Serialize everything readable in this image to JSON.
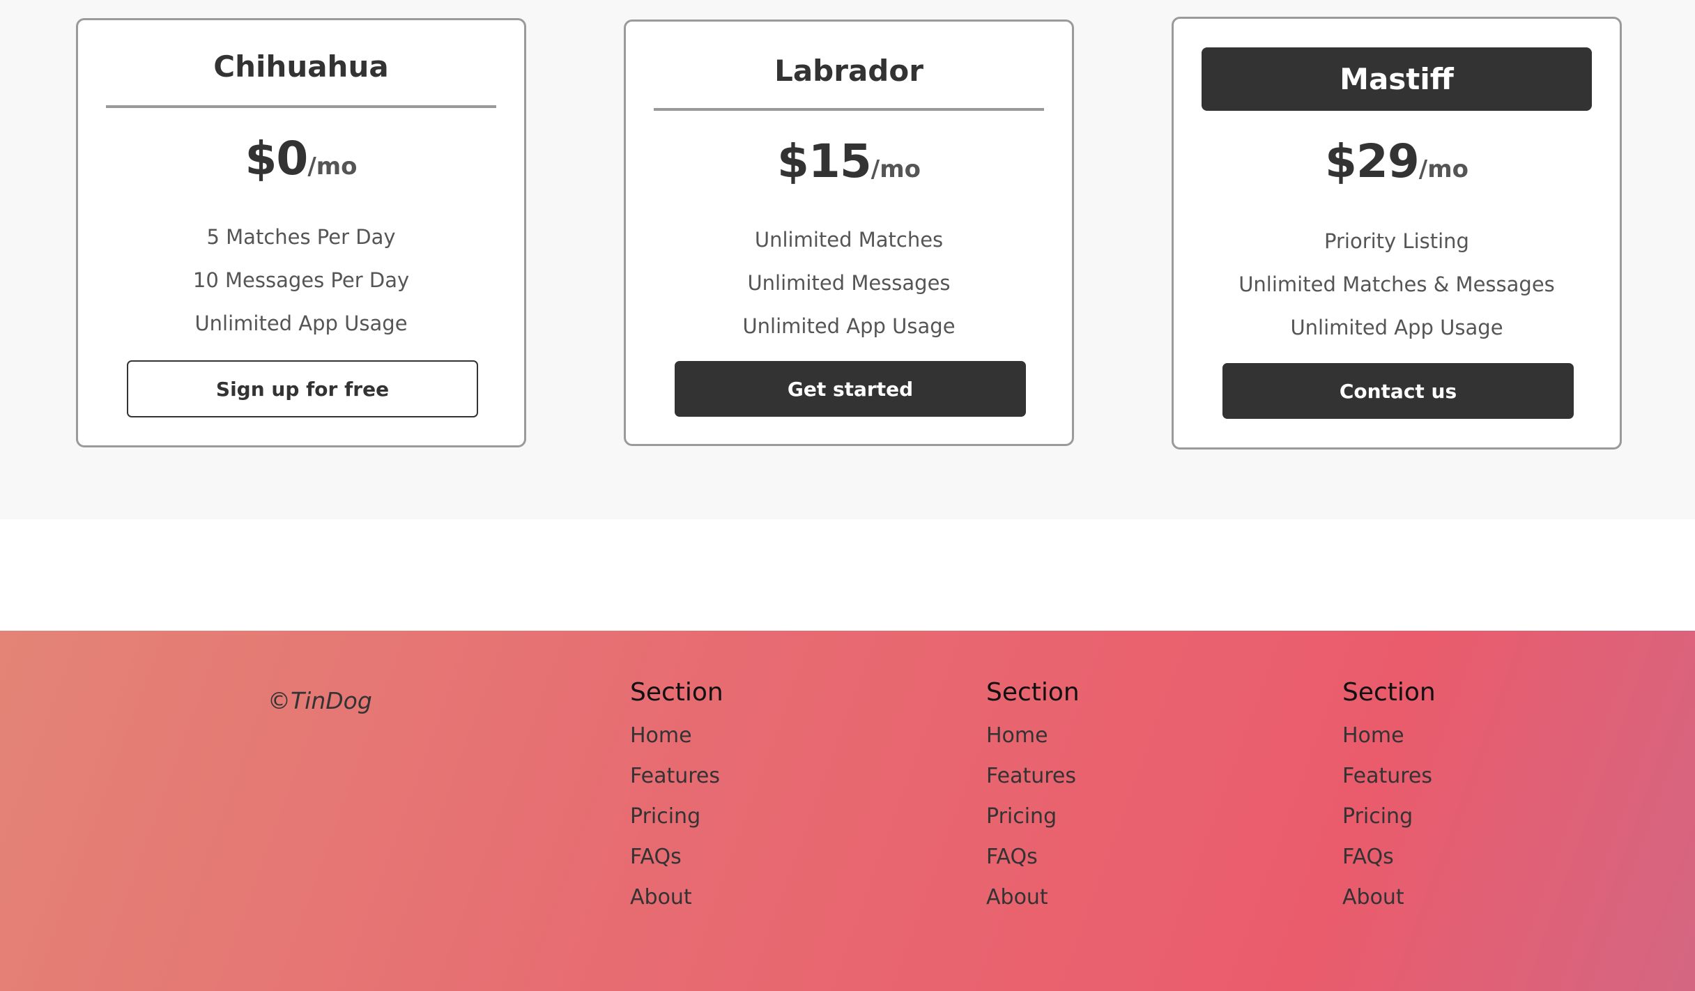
{
  "pricing": {
    "plans": [
      {
        "name": "Chihuahua",
        "price": "$0",
        "unit": "/mo",
        "features": [
          "5 Matches Per Day",
          "10 Messages Per Day",
          "Unlimited App Usage"
        ],
        "cta": "Sign up for free"
      },
      {
        "name": "Labrador",
        "price": "$15",
        "unit": "/mo",
        "features": [
          "Unlimited Matches",
          "Unlimited Messages",
          "Unlimited App Usage"
        ],
        "cta": "Get started"
      },
      {
        "name": "Mastiff",
        "price": "$29",
        "unit": "/mo",
        "features": [
          "Priority Listing",
          "Unlimited Matches & Messages",
          "Unlimited App Usage"
        ],
        "cta": "Contact us"
      }
    ]
  },
  "footer": {
    "copyright": "©TinDog",
    "columns": [
      {
        "title": "Section",
        "links": [
          "Home",
          "Features",
          "Pricing",
          "FAQs",
          "About"
        ]
      },
      {
        "title": "Section",
        "links": [
          "Home",
          "Features",
          "Pricing",
          "FAQs",
          "About"
        ]
      },
      {
        "title": "Section",
        "links": [
          "Home",
          "Features",
          "Pricing",
          "FAQs",
          "About"
        ]
      }
    ]
  },
  "colors": {
    "dark": "#333333",
    "border": "#9a9a9a",
    "footer_gradient_start": "#e38476",
    "footer_gradient_end": "#ea5c6c"
  }
}
